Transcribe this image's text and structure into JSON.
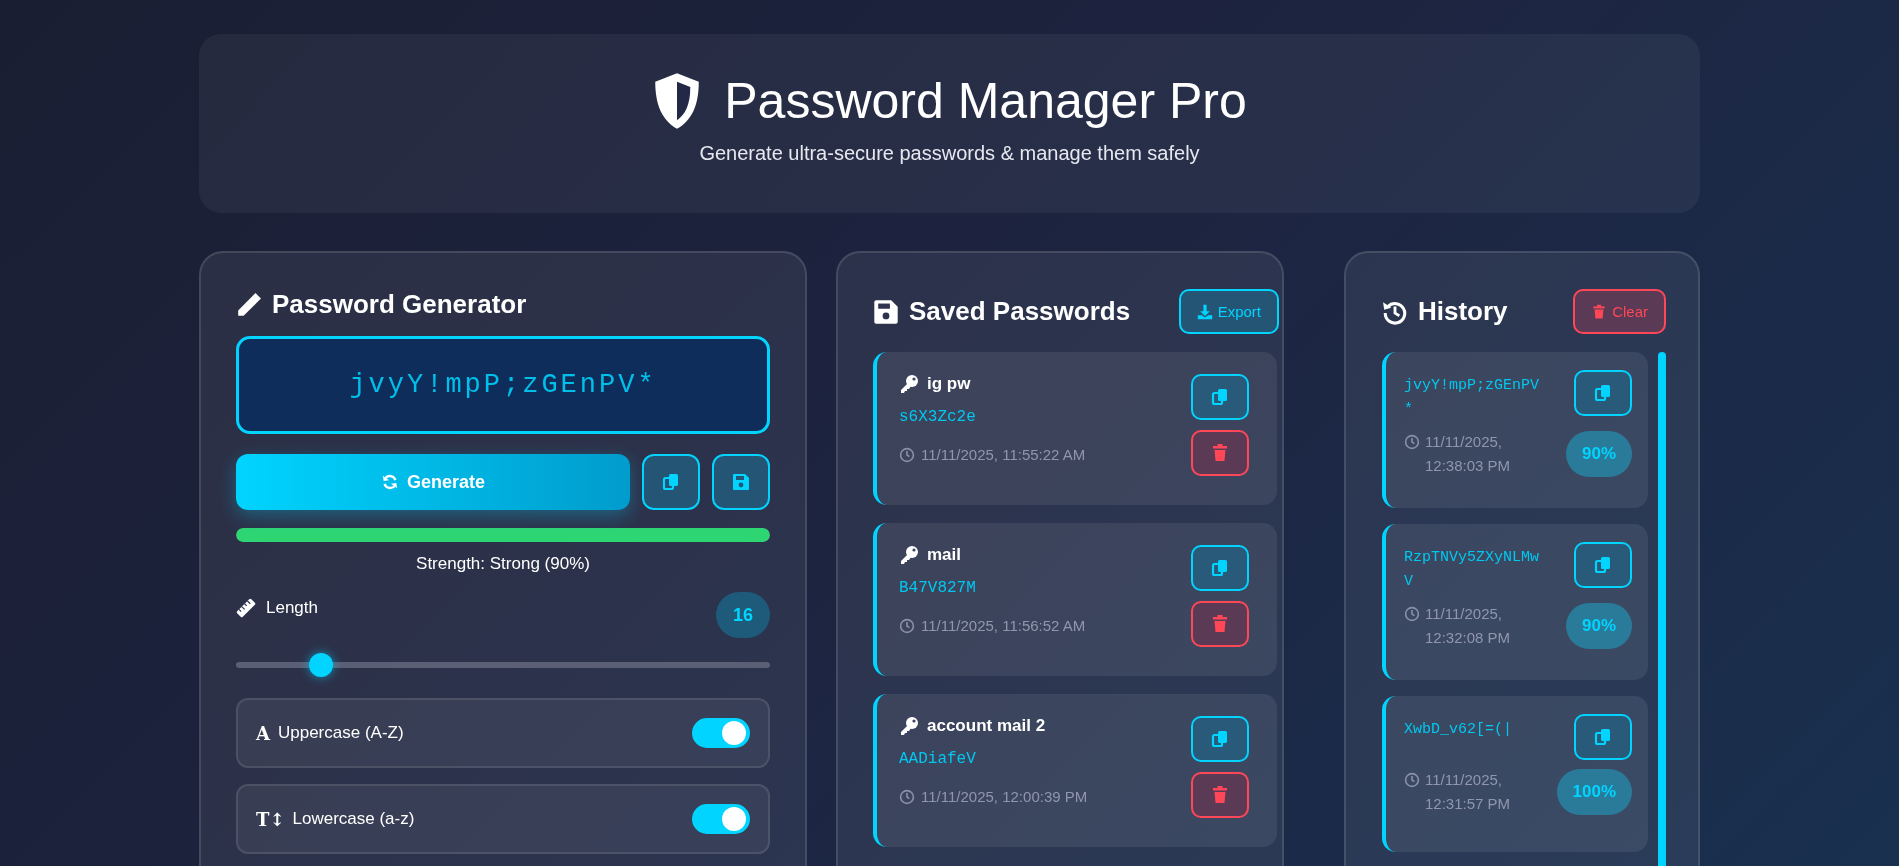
{
  "header": {
    "title": "Password Manager Pro",
    "subtitle": "Generate ultra-secure passwords & manage them safely"
  },
  "generator": {
    "title": "Password Generator",
    "password": "jvyY!mpP;zGEnPV*",
    "generate_label": "Generate",
    "strength": {
      "level": 1,
      "text": "Strength: Strong (90%)"
    },
    "length": {
      "label": "Length",
      "value": "16",
      "level": 0.16
    },
    "options": [
      {
        "icon": "A",
        "label": "Uppercase (A-Z)",
        "on": true
      },
      {
        "icon": "T↕",
        "label": "Lowercase (a-z)",
        "on": true
      }
    ]
  },
  "saved": {
    "title": "Saved Passwords",
    "export_label": "Export",
    "items": [
      {
        "name": "ig pw",
        "password": "s6X3Zc2e",
        "time": "11/11/2025, 11:55:22 AM"
      },
      {
        "name": "mail",
        "password": "B47V827M",
        "time": "11/11/2025, 11:56:52 AM"
      },
      {
        "name": "account mail 2",
        "password": "AADiafeV",
        "time": "11/11/2025, 12:00:39 PM"
      }
    ]
  },
  "history": {
    "title": "History",
    "clear_label": "Clear",
    "items": [
      {
        "password": "jvyY!mpP;zGEnPV*",
        "time": "11/11/2025, 12:38:03 PM",
        "score": "90%"
      },
      {
        "password": "RzpTNVy5ZXyNLMwV",
        "time": "11/11/2025, 12:32:08 PM",
        "score": "90%"
      },
      {
        "password": "XwbD_v62[=(|",
        "time": "11/11/2025, 12:31:57 PM",
        "score": "100%"
      }
    ]
  }
}
